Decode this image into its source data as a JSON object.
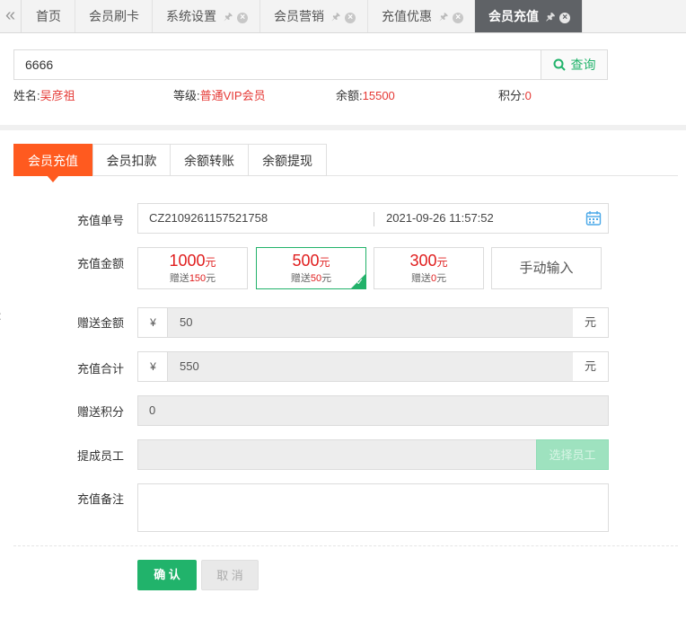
{
  "top_tabs": [
    {
      "label": "首页"
    },
    {
      "label": "会员刷卡"
    },
    {
      "label": "系统设置"
    },
    {
      "label": "会员营销"
    },
    {
      "label": "充值优惠"
    },
    {
      "label": "会员充值"
    }
  ],
  "search": {
    "value": "6666",
    "button_label": "查询"
  },
  "member": {
    "name_label": "姓名:",
    "name": "吴彦祖",
    "level_label": "等级:",
    "level": "普通VIP会员",
    "balance_label": "余额:",
    "balance": "15500",
    "points_label": "积分:",
    "points": "0"
  },
  "sub_tabs": [
    {
      "label": "会员充值",
      "active": true
    },
    {
      "label": "会员扣款"
    },
    {
      "label": "余额转账"
    },
    {
      "label": "余额提现"
    }
  ],
  "form": {
    "order_label": "充值单号",
    "order_no": "CZ2109261157521758",
    "order_date": "2021-09-26 11:57:52",
    "amount_label": "充值金额",
    "amounts": [
      {
        "value": "1000",
        "unit": "元",
        "gift_prefix": "赠送",
        "gift": "150",
        "gift_unit": "元",
        "selected": false
      },
      {
        "value": "500",
        "unit": "元",
        "gift_prefix": "赠送",
        "gift": "50",
        "gift_unit": "元",
        "selected": true
      },
      {
        "value": "300",
        "unit": "元",
        "gift_prefix": "赠送",
        "gift": "0",
        "gift_unit": "元",
        "selected": false
      }
    ],
    "manual_label": "手动输入",
    "gift_amount_label": "赠送金额",
    "gift_amount": "50",
    "total_label": "充值合计",
    "total": "550",
    "currency_symbol": "¥",
    "currency_unit": "元",
    "gift_points_label": "赠送积分",
    "gift_points": "0",
    "staff_label": "提成员工",
    "choose_staff_label": "选择员工",
    "remark_label": "充值备注",
    "confirm_label": "确 认",
    "cancel_label": "取 消"
  },
  "colors": {
    "accent_green": "#21b36b",
    "accent_orange": "#ff5a1f",
    "value_red": "#e53935"
  }
}
